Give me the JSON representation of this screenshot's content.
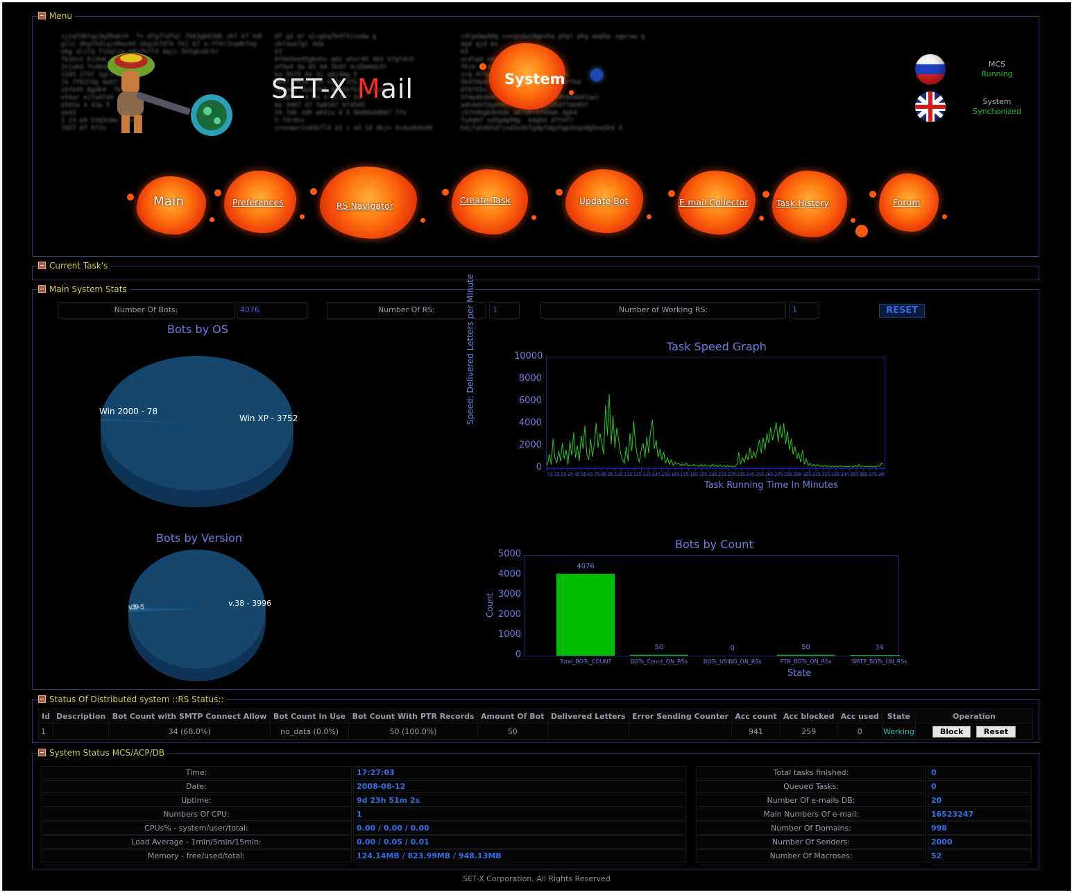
{
  "sections": {
    "menu": "Menu",
    "current_tasks": "Current Task's",
    "main_stats": "Main System Stats",
    "rs_status": "Status Of Distributed system ::RS Status::",
    "system_status": "System Status MCS/ACP/DB"
  },
  "logo": {
    "set_x": "SET-X",
    "m": "M",
    "ail": "ail",
    "system": "System"
  },
  "status": {
    "mcs_label": "MCS",
    "mcs_state": "Running",
    "system_label": "System",
    "system_state": "Synchonized",
    "state_color": "#1fb82a"
  },
  "nav": [
    "Main",
    "Preferences",
    "RS Navigator",
    "Create Task",
    "Update Bot",
    "E-mail Collector",
    "Task History",
    "Forum"
  ],
  "main_stats": {
    "bots_label": "Number Of Bots:",
    "bots_value": "4076",
    "rs_label": "Number Of RS:",
    "rs_value": "1",
    "working_rs_label": "Number of Working RS:",
    "working_rs_value": "1",
    "reset_button": "RESET"
  },
  "bots_by_os": {
    "title": "Bots by OS",
    "slices": [
      {
        "label": "Win XP - 3752",
        "value": 3752
      },
      {
        "label": "Win 2000 - 78",
        "value": 78
      }
    ]
  },
  "bots_by_version": {
    "title": "Bots by Version",
    "slices": [
      {
        "label": "v.38 - 3996",
        "value": 3996
      }
    ]
  },
  "chart_data": [
    {
      "type": "line",
      "title": "Task Speed Graph",
      "xlabel": "Task Running Time In Minutes",
      "ylabel": "Speed: Delivered Letters per Minute",
      "ylim": [
        0,
        10000
      ],
      "yticks": [
        "0",
        "2000",
        "4000",
        "6000",
        "8000",
        "10000"
      ],
      "series_color": "#22cc22",
      "y": [
        200,
        1200,
        300,
        2600,
        900,
        400,
        1500,
        600,
        2200,
        800,
        1600,
        300,
        2400,
        1100,
        3200,
        900,
        2000,
        600,
        2900,
        1700,
        3800,
        1200,
        700,
        2600,
        1000,
        2100,
        4000,
        1800,
        3100,
        2200,
        1200,
        5600,
        2900,
        6600,
        2100,
        4700,
        1800,
        3600,
        2500,
        1300,
        700,
        400,
        1900,
        600,
        3100,
        1500,
        4200,
        2100,
        1000,
        500,
        1600,
        2200,
        900,
        2800,
        1300,
        3300,
        4300,
        1700,
        2500,
        900,
        1700,
        700,
        1400,
        400,
        900,
        300,
        700,
        200,
        500,
        300,
        400,
        200,
        300,
        200,
        400,
        150,
        250,
        120,
        300,
        150,
        200,
        100,
        300,
        100,
        250,
        120,
        200,
        80,
        300,
        100,
        220,
        80,
        260,
        90,
        180,
        60,
        220,
        80,
        150,
        60,
        120,
        250,
        1400,
        300,
        900,
        500,
        1200,
        700,
        1800,
        800,
        1400,
        900,
        1700,
        2500,
        1300,
        2700,
        1600,
        3100,
        2200,
        3600,
        2500,
        3200,
        4100,
        2300,
        3800,
        2700,
        4000,
        2100,
        3300,
        1600,
        2600,
        1200,
        1900,
        800,
        1300,
        500,
        1600,
        300,
        800,
        200,
        400,
        150,
        300,
        120,
        260,
        100,
        200,
        90,
        220,
        80,
        180,
        70,
        160,
        80,
        150,
        60,
        200,
        70,
        140,
        60,
        120,
        80,
        160,
        60,
        200,
        70,
        260,
        90,
        180,
        60,
        120,
        80,
        160,
        60,
        140,
        70,
        180,
        100,
        420,
        300
      ]
    },
    {
      "type": "bar",
      "title": "Bots by Count",
      "xlabel": "State",
      "ylabel": "Count",
      "ylim": [
        0,
        5000
      ],
      "yticks": [
        "0",
        "1000",
        "2000",
        "3000",
        "4000",
        "5000"
      ],
      "categories": [
        "Total_BOTs_COUNT",
        "BOTs_Count_ON_RSs",
        "BOTs_USING_ON_RSs",
        "PTR_BOTs_ON_RSs",
        "SMTP_BOTs_ON_RSs"
      ],
      "values": [
        4076,
        50,
        0,
        50,
        34
      ],
      "bar_color": "#00bb00"
    }
  ],
  "rs_table": {
    "headers": [
      "Id",
      "Description",
      "Bot Count with SMTP Connect Allow",
      "Bot Count In Use",
      "Bot Count With PTR Records",
      "Amount Of Bot",
      "Delivered Letters",
      "Error Sending Counter",
      "Acc count",
      "Acc blocked",
      "Acc used",
      "State",
      "Operation"
    ],
    "rows": [
      [
        "1",
        "",
        "34 (68.0%)",
        "no_data (0.0%)",
        "50 (100.0%)",
        "50",
        "",
        "",
        "941",
        "259",
        "0",
        "Working"
      ]
    ],
    "state_color": "#21c0c0",
    "block_button": "Block",
    "reset_button": "Reset"
  },
  "system_status": {
    "left": [
      {
        "label": "Time:",
        "value": "17:27:03"
      },
      {
        "label": "Date:",
        "value": "2008-08-12"
      },
      {
        "label": "Uptime:",
        "value": "9d 23h 51m 2s"
      },
      {
        "label": "Numbers Of CPU:",
        "value": "1"
      },
      {
        "label": "CPUs% - system/user/total:",
        "value": "0.00 / 0.00 / 0.00"
      },
      {
        "label": "Load Average - 1min/5min/15min:",
        "value": "0.00 / 0.05 / 0.01"
      },
      {
        "label": "Memory - free/used/total:",
        "value": "124.14MB / 823.99MB / 948.13MB"
      }
    ],
    "right": [
      {
        "label": "Total tasks finished:",
        "value": "0"
      },
      {
        "label": "Queued Tasks:",
        "value": "0"
      },
      {
        "label": "Number Of e-mails DB:",
        "value": "20"
      },
      {
        "label": "Main Numbers Of e-mail:",
        "value": "16523247"
      },
      {
        "label": "Number Of Domains:",
        "value": "998"
      },
      {
        "label": "Number Of Senders:",
        "value": "2000"
      },
      {
        "label": "Number Of Macroses:",
        "value": "52"
      }
    ]
  },
  "footer": "SET-X Corporation. All Rights Reserved"
}
